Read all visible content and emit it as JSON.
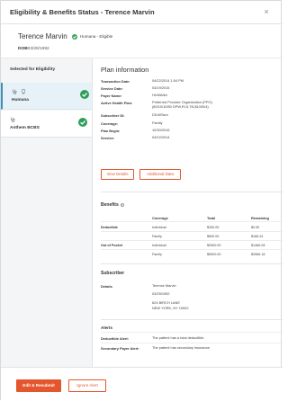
{
  "modal": {
    "title": "Eligibility & Benefits Status - Terence Marvin",
    "close_glyph": "×"
  },
  "patient": {
    "name": "Terence Marvin",
    "eligibility": "Humana - Eligible",
    "dob_label": "DOB",
    "dob": "03/25/1992"
  },
  "sidebar": {
    "heading": "Selected for Eligibility",
    "payers": [
      {
        "label": "Humana",
        "selected": true
      },
      {
        "label": "Anthem BCBS",
        "selected": false
      }
    ]
  },
  "plan": {
    "title": "Plan information",
    "rows": [
      {
        "label": "Transaction Date:",
        "value": "04/22/2014 1:54 PM"
      },
      {
        "label": "Service Date:",
        "value": "03/19/2015"
      },
      {
        "label": "Payer Name:",
        "value": "HUMANA"
      },
      {
        "label": "Active Health Plan:",
        "value": "Preferred Provider Organization (PPO)",
        "value2": "(80/10/10/50 DPW,RI,5,TN,$1000/4)"
      },
      {
        "label": "Subscriber ID:",
        "value": "DD40Ssm"
      },
      {
        "label": "Coverage:",
        "value": "Family"
      },
      {
        "label": "Plan Begin:",
        "value": "10/30/2016"
      },
      {
        "label": "Service:",
        "value": "04/22/2014"
      }
    ],
    "view_details_label": "View Details",
    "additional_data_label": "Additional Data"
  },
  "benefits": {
    "title": "Benefits",
    "headers": [
      "Coverage",
      "Total",
      "Remaining"
    ],
    "rows": [
      {
        "type": "Deductible",
        "coverage": "Individual",
        "total": "$250.00",
        "remaining": "$0.00"
      },
      {
        "type": "",
        "coverage": "Family",
        "total": "$500.00",
        "remaining": "$166.24"
      },
      {
        "type": "Out of Pocket",
        "coverage": "Individual",
        "total": "$2500.00",
        "remaining": "$1466.28"
      },
      {
        "type": "",
        "coverage": "Family",
        "total": "$5000.00",
        "remaining": "$3966.18"
      }
    ]
  },
  "subscriber": {
    "title": "Subscriber",
    "details_label": "Details",
    "name": "Terence Marvin",
    "dob": "03/25/1992",
    "address1": "624 BIRCH LANE",
    "address2": "NEW YORK, NY 10002"
  },
  "alerts": {
    "title": "Alerts",
    "rows": [
      {
        "label": "Deductible Alert:",
        "value": "The patient has a total deductible."
      },
      {
        "label": "Secondary Payer Alert:",
        "value": "The patient has secondary insurance."
      }
    ]
  },
  "footer": {
    "primary_label": "Edit & Resubmit",
    "secondary_label": "Ignore Alert"
  },
  "colors": {
    "accent": "#e4572e",
    "success": "#2e9e59",
    "selected_bg": "#e6f2f8"
  }
}
